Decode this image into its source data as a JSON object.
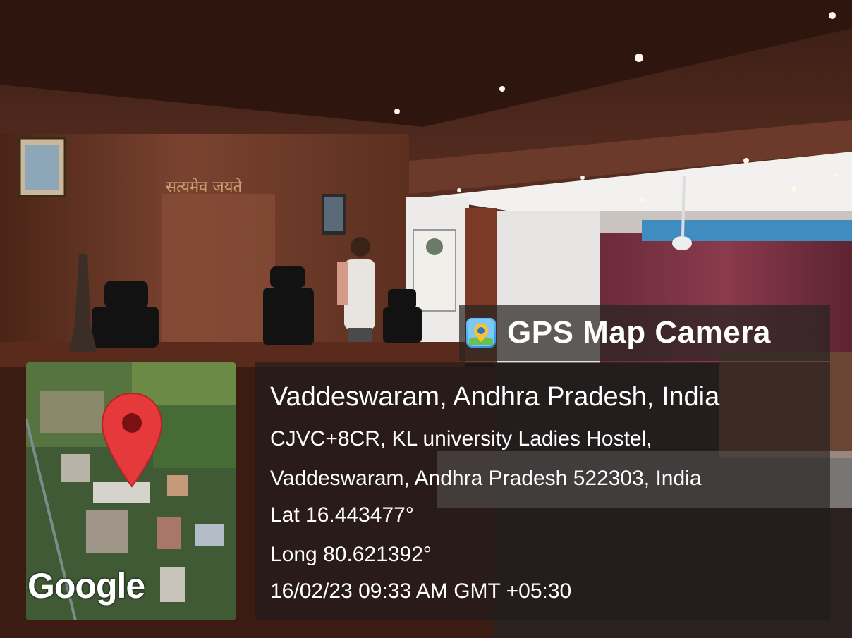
{
  "photo": {
    "wall_inscription": "सत्यमेव जयते"
  },
  "overlay": {
    "app_name": "GPS Map Camera",
    "app_icon": "gps-map-camera-icon",
    "location_title": "Vaddeswaram, Andhra Pradesh, India",
    "address_line1": "CJVC+8CR, KL university Ladies Hostel,",
    "address_line2": "Vaddeswaram, Andhra Pradesh 522303, India",
    "latitude": "Lat 16.443477°",
    "longitude": "Long 80.621392°",
    "datetime": "16/02/23 09:33 AM GMT +05:30",
    "map_brand": "Google",
    "map_pin_icon": "map-pin-icon",
    "colors": {
      "pin": "#e5393b",
      "panel": "#1e1c1c"
    }
  }
}
